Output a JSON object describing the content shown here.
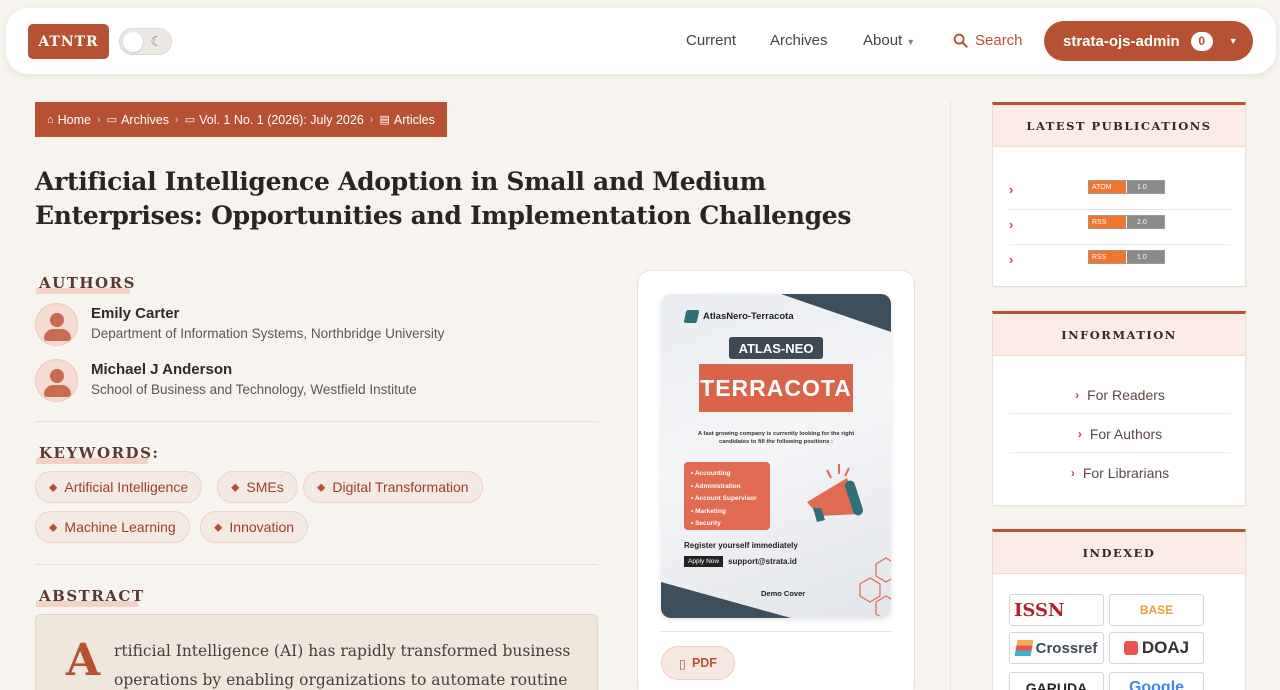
{
  "header": {
    "logo": "ATNTR",
    "nav": {
      "current": "Current",
      "archives": "Archives",
      "about": "About"
    },
    "search": "Search",
    "user": {
      "name": "strata-ojs-admin",
      "count": "0"
    }
  },
  "breadcrumb": [
    "Home",
    "Archives",
    "Vol. 1 No. 1 (2026): July 2026",
    "Articles"
  ],
  "article": {
    "title": "Artificial Intelligence Adoption in Small and Medium Enterprises: Opportunities and Implementation Challenges",
    "authors_heading": "AUTHORS",
    "authors": [
      {
        "name": "Emily Carter",
        "affiliation": "Department of Information Systems, Northbridge University"
      },
      {
        "name": "Michael J Anderson",
        "affiliation": "School of Business and Technology, Westfield Institute"
      }
    ],
    "keywords_heading": "KEYWORDS:",
    "keywords": [
      "Artificial Intelligence",
      "SMEs",
      "Digital Transformation",
      "Machine Learning",
      "Innovation"
    ],
    "abstract_heading": "ABSTRACT",
    "abstract_dropcap": "A",
    "abstract_line1": "rtificial Intelligence (AI) has rapidly transformed business",
    "abstract_line2": "operations by enabling organizations to automate routine"
  },
  "cover": {
    "brand": "AtlasNero-Terracota",
    "pill": "ATLAS-NEO",
    "main": "TERRACOTA",
    "desc": "A fast growing company is currently looking for the right candidates to fill the following positions :",
    "positions": [
      "Accounting",
      "Administration",
      "Account Supervisor",
      "Marketing",
      "Security"
    ],
    "register": "Register yourself immediately",
    "apply": "Apply Now",
    "email": "support@strata.id",
    "demo": "Demo Cover"
  },
  "pdf_label": "PDF",
  "sidebar": {
    "latest": {
      "title": "LATEST PUBLICATIONS",
      "feeds": [
        {
          "left": "ATOM",
          "right": "1.0"
        },
        {
          "left": "RSS",
          "right": "2.0"
        },
        {
          "left": "RSS",
          "right": "1.0"
        }
      ]
    },
    "information": {
      "title": "INFORMATION",
      "items": [
        "For Readers",
        "For Authors",
        "For Librarians"
      ]
    },
    "indexed": {
      "title": "INDEXED",
      "logos": [
        "ISSN",
        "BASE",
        "Crossref",
        "DOAJ",
        "GARUDA",
        "Google"
      ]
    }
  },
  "colors": {
    "accent": "#b65134",
    "background": "#f7f3ee"
  }
}
